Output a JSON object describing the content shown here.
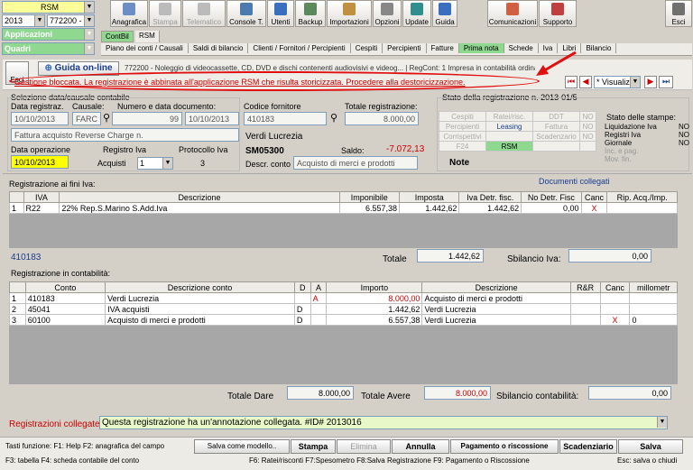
{
  "top": {
    "company": "RSM",
    "year": "2013",
    "code": "772200 -",
    "apps": "Applicazioni",
    "quadri": "Quadri"
  },
  "toolbar": [
    "Anagrafica",
    "Stampa",
    "Telematico",
    "Console T.",
    "Utenti",
    "Backup",
    "Importazioni",
    "Opzioni",
    "Update",
    "Guida",
    "Comunicazioni",
    "Supporto",
    "Esci"
  ],
  "tabs": [
    "ContBil",
    "RSM"
  ],
  "subtabs": [
    "Piano dei conti / Causali",
    "Saldi di bilancio",
    "Clienti / Fornitori / Percipienti",
    "Cespiti",
    "Percipienti",
    "Fatture",
    "Prima nota",
    "Schede",
    "Iva",
    "Libri",
    "Bilancio"
  ],
  "header": {
    "esci": "Esci",
    "guida": "Guida on-line",
    "company_line": "772200 - Noleggio di videocassette, CD, DVD e dischi contenenti audiovisivi e videog... | RegCont: 1 Impresa in contabilità ordinaria",
    "warning": "Gestione bloccata. La registrazione è abbinata all'applicazione RSM che risulta storicizzata. Procedere alla destoricizzazione.",
    "visual": "Visualiz"
  },
  "selezione": {
    "title": "Selezione data/causale contabile",
    "data_reg_label": "Data registraz.",
    "data_reg": "10/10/2013",
    "causale_label": "Causale:",
    "causale": "FARC",
    "num_label": "Numero e data documento:",
    "num": "99",
    "data_doc": "10/10/2013",
    "descr": "Fattura acquisto Reverse Charge n.",
    "data_op_label": "Data operazione",
    "data_op": "10/10/2013",
    "reg_iva_label": "Registro Iva",
    "reg_iva": "Acquisti",
    "reg_iva_num": "1",
    "protocollo_label": "Protocollo Iva",
    "protocollo": "3"
  },
  "fornitore": {
    "codice_label": "Codice fornitore",
    "codice": "410183",
    "totale_label": "Totale registrazione:",
    "totale": "8.000,00",
    "nome": "Verdi Lucrezia",
    "sm": "SM05300",
    "saldo_label": "Saldo:",
    "saldo": "-7.072,13",
    "descr_conto_label": "Descr. conto",
    "descr_conto": "Acquisto di merci e prodotti"
  },
  "stato": {
    "title": "Stato della registrazione n. 2013-01/5",
    "cells": [
      [
        "Cespiti",
        "Ratei/risc.",
        "DDT",
        "NO"
      ],
      [
        "Percipienti",
        "Leasing",
        "Fattura",
        "NO"
      ],
      [
        "Corrispettivi",
        "",
        "Scadenzario",
        "NO"
      ],
      [
        "F24",
        "RSM",
        "",
        ""
      ]
    ],
    "note": "Note",
    "stampe_title": "Stato delle stampe:",
    "stampe": [
      [
        "Liquidazione Iva",
        "NO"
      ],
      [
        "Registri Iva",
        "NO"
      ],
      [
        "Giornale",
        "NO"
      ],
      [
        "Inc. e pag.",
        ""
      ],
      [
        "Mov. fin.",
        ""
      ]
    ]
  },
  "iva": {
    "title": "Registrazione ai fini Iva:",
    "doc_link": "Documenti collegati",
    "cols": [
      "IVA",
      "Descrizione",
      "Imponibile",
      "Imposta",
      "Iva Detr. fisc.",
      "No Detr. Fisc",
      "Canc",
      "Rip. Acq./Imp."
    ],
    "rows": [
      [
        "1",
        "R22",
        "22% Rep.S.Marino S.Add.Iva",
        "6.557,38",
        "1.442,62",
        "1.442,62",
        "0,00",
        "X",
        ""
      ]
    ],
    "code": "410183",
    "totale_label": "Totale",
    "totale": "1.442,62",
    "sbil_label": "Sbilancio Iva:",
    "sbil": "0,00"
  },
  "cont": {
    "title": "Registrazione in contabilità:",
    "cols": [
      "Conto",
      "Descrizione conto",
      "D",
      "A",
      "Importo",
      "Descrizione",
      "R&R",
      "Canc",
      "millometr"
    ],
    "rows": [
      [
        "1",
        "410183",
        "Verdi Lucrezia",
        "",
        "A",
        "8.000,00",
        "Acquisto di merci e prodotti",
        "",
        "",
        ""
      ],
      [
        "2",
        "45041",
        "IVA acquisti",
        "D",
        "",
        "1.442,62",
        "Verdi Lucrezia",
        "",
        "",
        ""
      ],
      [
        "3",
        "60100",
        "Acquisto di merci e prodotti",
        "D",
        "",
        "6.557,38",
        "Verdi Lucrezia",
        "",
        "X",
        "0"
      ]
    ],
    "dare_label": "Totale Dare",
    "dare": "8.000,00",
    "avere_label": "Totale Avere",
    "avere": "8.000,00",
    "sbil_label": "Sbilancio contabilità:",
    "sbil": "0,00"
  },
  "collegate": {
    "label": "Registrazioni collegate:",
    "value": "Questa registrazione ha un'annotazione collegata. #ID# 2013016"
  },
  "footer": {
    "keys1": "Tasti funzione: F1: Help  F2: anagrafica del campo",
    "keys2": "F3: tabella   F4: scheda contabile del conto",
    "keys3": "F6: Ratei/risconti   F7:Spesometro   F8:Salva Registrazione   F9: Pagamento o Riscossione",
    "keys4": "Esc: salva o chiudi",
    "buttons": [
      "Salva come modello..",
      "Stampa",
      "Elimina",
      "Annulla",
      "Pagamento o riscossione",
      "Scadenziario",
      "Salva"
    ]
  },
  "colors": {
    "warning": "#cc0000",
    "green": "#8fd88f",
    "highlight": "#ffff00"
  }
}
